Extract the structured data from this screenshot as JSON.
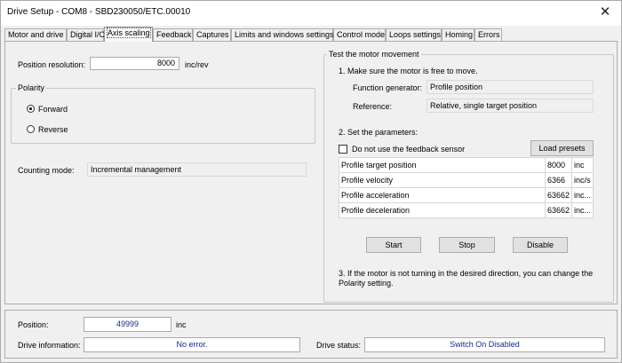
{
  "window": {
    "title": "Drive Setup - COM8 - SBD230050/ETC.00010",
    "close_glyph": "✕"
  },
  "tabs": [
    {
      "label": "Motor and drive"
    },
    {
      "label": "Digital I/O"
    },
    {
      "label": "Axis scaling",
      "active": true
    },
    {
      "label": "Feedback"
    },
    {
      "label": "Captures"
    },
    {
      "label": "Limits and windows settings"
    },
    {
      "label": "Control mode"
    },
    {
      "label": "Loops settings"
    },
    {
      "label": "Homing"
    },
    {
      "label": "Errors"
    }
  ],
  "axis_scaling": {
    "position_resolution_label": "Position resolution:",
    "position_resolution_value": "8000",
    "position_resolution_unit": "inc/rev",
    "polarity": {
      "title": "Polarity",
      "forward_label": "Forward",
      "reverse_label": "Reverse",
      "selected": "Forward"
    },
    "counting_mode_label": "Counting mode:",
    "counting_mode_value": "Incremental management"
  },
  "test_movement": {
    "title": "Test the motor movement",
    "step1": "1. Make sure the motor is free to move.",
    "function_generator_label": "Function generator:",
    "function_generator_value": "Profile position",
    "reference_label": "Reference:",
    "reference_value": "Relative, single target position",
    "step2": "2. Set the parameters:",
    "no_feedback_label": "Do not use the feedback sensor",
    "no_feedback_checked": false,
    "load_presets_label": "Load presets",
    "parameters": [
      {
        "name": "Profile target position",
        "value": "8000",
        "unit": "inc"
      },
      {
        "name": "Profile velocity",
        "value": "6366",
        "unit": "inc/s"
      },
      {
        "name": "Profile acceleration",
        "value": "63662",
        "unit": "inc..."
      },
      {
        "name": "Profile deceleration",
        "value": "63662",
        "unit": "inc..."
      }
    ],
    "start_label": "Start",
    "stop_label": "Stop",
    "disable_label": "Disable",
    "step3": "3. If the motor is not turning in the desired direction, you can change the Polarity setting."
  },
  "status": {
    "position_label": "Position:",
    "position_value": "49999",
    "position_unit": "inc",
    "drive_info_label": "Drive information:",
    "drive_info_value": "No error.",
    "drive_status_label": "Drive status:",
    "drive_status_value": "Switch On Disabled"
  }
}
